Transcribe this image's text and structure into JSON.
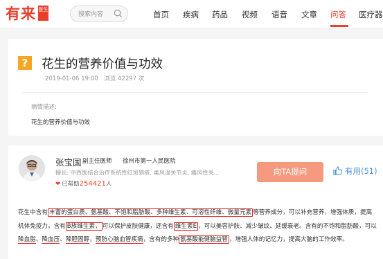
{
  "header": {
    "logo_text": "有来",
    "logo_badge": "医生",
    "search_placeholder": "搜索内容",
    "nav": [
      "首页",
      "疾病",
      "药品",
      "视频",
      "语音",
      "文章",
      "问答",
      "医疗器"
    ],
    "active_nav": "问答"
  },
  "question": {
    "title": "花生的营养价值与功效",
    "date": "2019-01-06 19:00",
    "views": "浏览 42297 次",
    "desc_label": "病情描述:",
    "desc_text": "花生的营养价值与功效"
  },
  "doctor": {
    "name": "张宝国",
    "title": "副主任医师",
    "hospital": "徐州市第一人民医院",
    "skills": "擅长: 中西医结合治疗系统性红斑狼疮, 类风湿关节炎, 痛风性关...",
    "helped_prefix": "已帮助",
    "helped_count": "254421",
    "helped_suffix": "人",
    "ask_label": "向TA提问",
    "useful_label": "有用(51)"
  },
  "answer": {
    "segments": [
      "花生中含有",
      "丰富的蛋白质、氨基酸、不饱和脂肪酸、多种维生素、可溶性纤维、微量元素",
      "等营养成分，可以补充营养，增强体质，提高机体免疫力。含有",
      "B族维生素，",
      "可以保护皮肤健康，还含有",
      "维生素E",
      "，可以美容护肤、减少皱纹、延缓衰老。含有的不饱和脂肪酸，可以",
      "降血脂",
      "、",
      "降血压",
      "、",
      "降胆固醇",
      "，",
      "预防心脑血管疾病",
      "，含有的多种",
      "氨基酸能健脑益智",
      "，增强人体的记忆力，提高大脑的工作效率。"
    ]
  },
  "colors": {
    "brand": "#e8402b",
    "question_mark": "#f5a623",
    "ask_button": "#f59a7e",
    "useful": "#4a90d9",
    "annotation": "#e22222"
  }
}
